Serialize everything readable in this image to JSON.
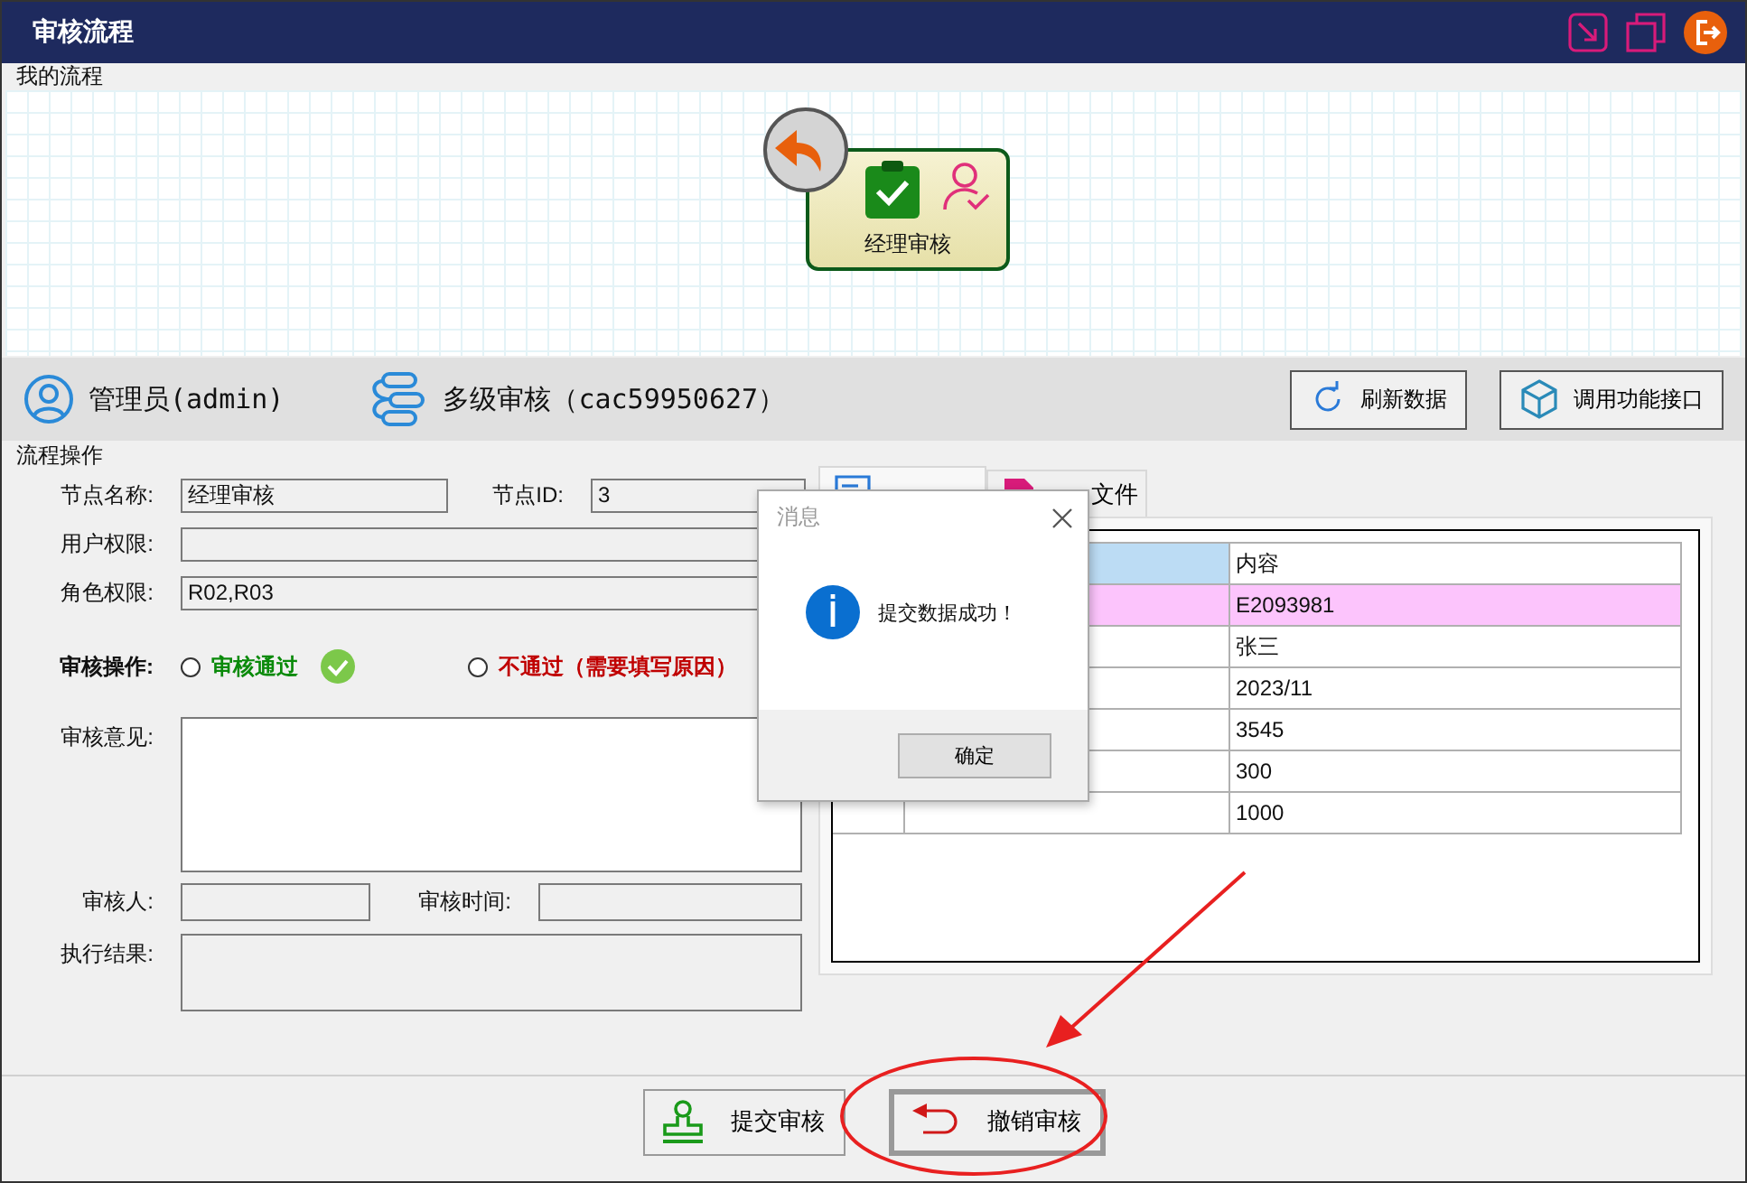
{
  "window": {
    "title": "审核流程"
  },
  "flow": {
    "label": "我的流程",
    "nodes": [
      {
        "label": "经理审核"
      }
    ]
  },
  "info": {
    "user": "管理员(admin)",
    "process": "多级审核（cac59950627）",
    "buttons": [
      {
        "kind": "refresh",
        "label": "刷新数据"
      },
      {
        "kind": "api",
        "label": "调用功能接口"
      }
    ]
  },
  "operation": {
    "label": "流程操作",
    "node_name": {
      "label": "节点名称:",
      "value": "经理审核"
    },
    "node_id": {
      "label": "节点ID:",
      "value": "3"
    },
    "user_permission": {
      "label": "用户权限:"
    },
    "role_permission": {
      "label": "角色权限:",
      "value": "R02,R03"
    },
    "review_action": {
      "label": "审核操作:",
      "options": [
        {
          "label": "审核通过",
          "kind": "pass",
          "selected": false
        },
        {
          "label": "不通过（需要填写原因）",
          "kind": "reject",
          "selected": false
        }
      ]
    },
    "opinion": {
      "label": "审核意见:"
    },
    "reviewer": {
      "label": "审核人:"
    },
    "review_time": {
      "label": "审核时间:"
    },
    "result": {
      "label": "执行结果:"
    }
  },
  "tabs": [
    {
      "kind": "data",
      "selected": true
    },
    {
      "kind": "file",
      "label": "文件",
      "selected": false
    }
  ],
  "table": {
    "column_2": "内容",
    "rows": [
      {
        "column_2": "E2093981",
        "highlighted": true
      },
      {
        "column_2": "张三",
        "highlighted": false
      },
      {
        "column_2": "2023/11",
        "highlighted": false
      },
      {
        "column_2": "3545",
        "highlighted": false
      },
      {
        "column_2": "300",
        "highlighted": false
      },
      {
        "column_2": "1000",
        "highlighted": false
      }
    ]
  },
  "actions": [
    {
      "kind": "submit",
      "label": "提交审核",
      "focused": false
    },
    {
      "kind": "revoke",
      "label": "撤销审核",
      "focused": true
    }
  ],
  "dialog": {
    "title": "消息",
    "message": "提交数据成功！",
    "button": "确定"
  }
}
